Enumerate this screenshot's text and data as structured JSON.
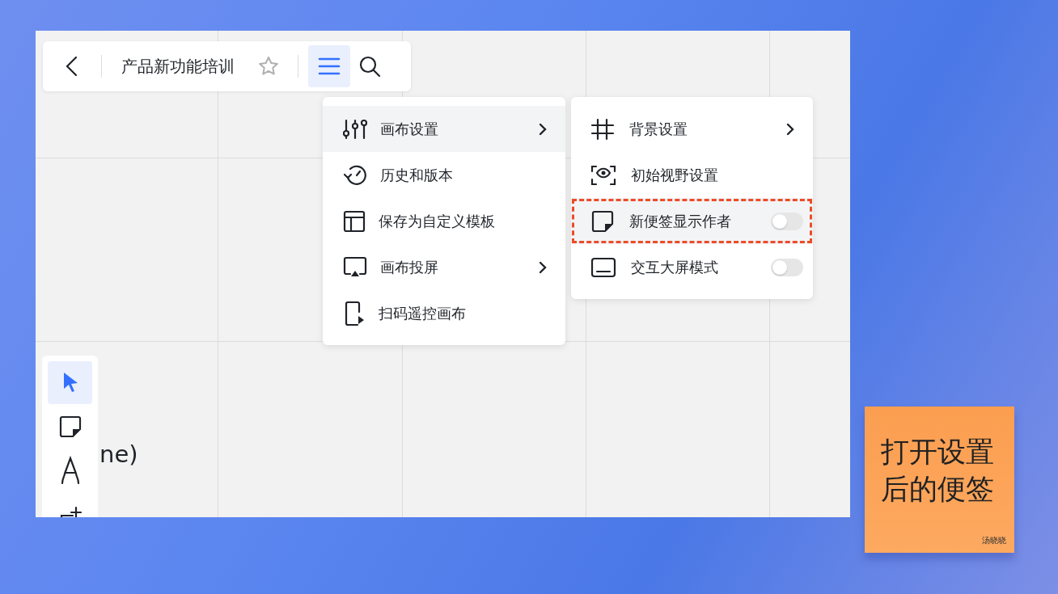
{
  "toolbar": {
    "title": "产品新功能培训",
    "starred": false,
    "menu_open": true
  },
  "menu": [
    {
      "label": "画布设置",
      "submenu": true,
      "selected": true
    },
    {
      "label": "历史和版本",
      "submenu": false,
      "selected": false
    },
    {
      "label": "保存为自定义模板",
      "submenu": false,
      "selected": false
    },
    {
      "label": "画布投屏",
      "submenu": true,
      "selected": false
    },
    {
      "label": "扫码遥控画布",
      "submenu": false,
      "selected": false
    }
  ],
  "submenu": [
    {
      "kind": "submenu",
      "label": "背景设置",
      "selected": false,
      "outlined": false
    },
    {
      "kind": "plain",
      "label": "初始视野设置",
      "selected": false,
      "outlined": false
    },
    {
      "kind": "toggle",
      "label": "新便签显示作者",
      "on": false,
      "selected": true,
      "outlined": true
    },
    {
      "kind": "toggle",
      "label": "交互大屏模式",
      "on": false,
      "selected": false,
      "outlined": false
    }
  ],
  "tools": [
    {
      "selected": true
    },
    {
      "selected": false
    },
    {
      "selected": false
    },
    {
      "selected": false
    }
  ],
  "canvas_text": [
    "ne)"
  ],
  "sticky_note": {
    "lines": [
      "打开设置",
      "后的便签"
    ],
    "author": "汤晓晓"
  }
}
